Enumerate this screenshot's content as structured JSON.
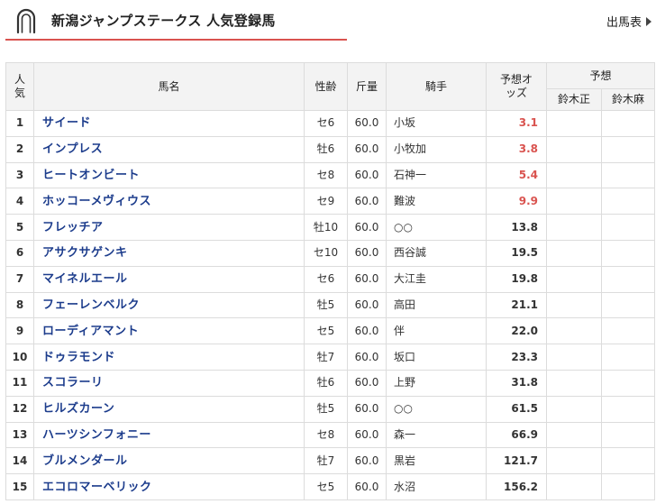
{
  "header": {
    "title": "新潟ジャンプステークス 人気登録馬",
    "entries_link": "出馬表"
  },
  "colors": {
    "accent": "#d9534f",
    "horse_name": "#1c3c8c",
    "header_bg": "#f3f3f3",
    "border": "#dcdcdc"
  },
  "table": {
    "headers": {
      "rank": "人気",
      "name": "馬名",
      "sex_age": "性齢",
      "weight": "斤量",
      "jockey": "騎手",
      "odds": "予想オッズ",
      "prediction": "予想",
      "pred1": "鈴木正",
      "pred2": "鈴木麻"
    },
    "rows": [
      {
        "rank": "1",
        "name": "サイード",
        "sex_age": "セ6",
        "weight": "60.0",
        "jockey": "小坂",
        "odds": "3.1",
        "hot": true
      },
      {
        "rank": "2",
        "name": "インプレス",
        "sex_age": "牡6",
        "weight": "60.0",
        "jockey": "小牧加",
        "odds": "3.8",
        "hot": true
      },
      {
        "rank": "3",
        "name": "ヒートオンビート",
        "sex_age": "セ8",
        "weight": "60.0",
        "jockey": "石神一",
        "odds": "5.4",
        "hot": true
      },
      {
        "rank": "4",
        "name": "ホッコーメヴィウス",
        "sex_age": "セ9",
        "weight": "60.0",
        "jockey": "難波",
        "odds": "9.9",
        "hot": true
      },
      {
        "rank": "5",
        "name": "フレッチア",
        "sex_age": "牡10",
        "weight": "60.0",
        "jockey": "○○",
        "odds": "13.8",
        "hot": false
      },
      {
        "rank": "6",
        "name": "アサクサゲンキ",
        "sex_age": "セ10",
        "weight": "60.0",
        "jockey": "西谷誠",
        "odds": "19.5",
        "hot": false
      },
      {
        "rank": "7",
        "name": "マイネルエール",
        "sex_age": "セ6",
        "weight": "60.0",
        "jockey": "大江圭",
        "odds": "19.8",
        "hot": false
      },
      {
        "rank": "8",
        "name": "フェーレンベルク",
        "sex_age": "牡5",
        "weight": "60.0",
        "jockey": "高田",
        "odds": "21.1",
        "hot": false
      },
      {
        "rank": "9",
        "name": "ローディアマント",
        "sex_age": "セ5",
        "weight": "60.0",
        "jockey": "伴",
        "odds": "22.0",
        "hot": false
      },
      {
        "rank": "10",
        "name": "ドゥラモンド",
        "sex_age": "牡7",
        "weight": "60.0",
        "jockey": "坂口",
        "odds": "23.3",
        "hot": false
      },
      {
        "rank": "11",
        "name": "スコラーリ",
        "sex_age": "牡6",
        "weight": "60.0",
        "jockey": "上野",
        "odds": "31.8",
        "hot": false
      },
      {
        "rank": "12",
        "name": "ヒルズカーン",
        "sex_age": "牡5",
        "weight": "60.0",
        "jockey": "○○",
        "odds": "61.5",
        "hot": false
      },
      {
        "rank": "13",
        "name": "ハーツシンフォニー",
        "sex_age": "セ8",
        "weight": "60.0",
        "jockey": "森一",
        "odds": "66.9",
        "hot": false
      },
      {
        "rank": "14",
        "name": "ブルメンダール",
        "sex_age": "牡7",
        "weight": "60.0",
        "jockey": "黒岩",
        "odds": "121.7",
        "hot": false
      },
      {
        "rank": "15",
        "name": "エコロマーベリック",
        "sex_age": "セ5",
        "weight": "60.0",
        "jockey": "水沼",
        "odds": "156.2",
        "hot": false
      }
    ]
  }
}
